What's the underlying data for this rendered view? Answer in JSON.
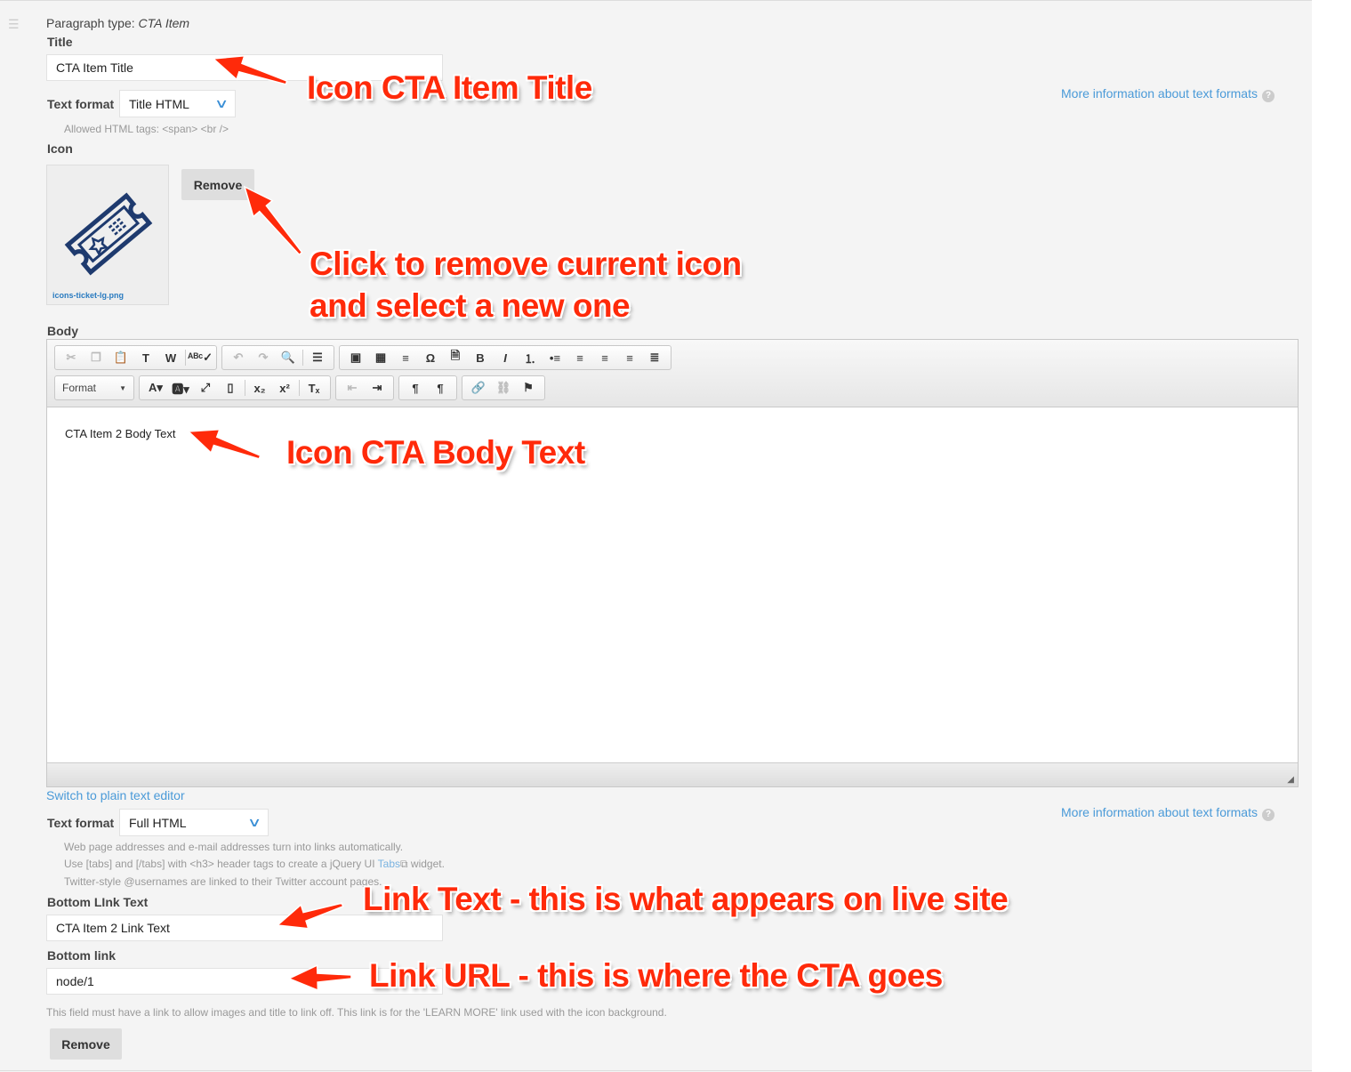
{
  "paragraph_type_prefix": "Paragraph type: ",
  "paragraph_type": "CTA Item",
  "title": {
    "label": "Title",
    "value": "CTA Item Title"
  },
  "title_format": {
    "label": "Text format",
    "value": "Title HTML",
    "help": "Allowed HTML tags: <span> <br />",
    "more_info": "More information about text formats"
  },
  "icon": {
    "label": "Icon",
    "filename": "icons-ticket-lg.png",
    "remove_label": "Remove"
  },
  "body": {
    "label": "Body",
    "content": "CTA Item 2 Body Text",
    "format_dropdown": "Format",
    "toolbar_row1": [
      [
        "cut",
        "copy",
        "paste",
        "paste-text",
        "paste-word",
        "|",
        "spellcheck"
      ],
      [
        "undo",
        "redo",
        "find",
        "|",
        "select-all"
      ],
      [
        "image",
        "table",
        "horizontal-rule",
        "special-char",
        "page-break",
        "bold",
        "italic",
        "numbered-list",
        "bulleted-list",
        "align-left",
        "align-center",
        "align-right",
        "align-justify"
      ]
    ],
    "toolbar_row2": [
      [
        "text-color",
        "bg-color",
        "maximize",
        "show-blocks",
        "|",
        "subscript",
        "superscript",
        "|",
        "remove-format"
      ],
      [
        "outdent",
        "indent"
      ],
      [
        "ltr",
        "rtl"
      ],
      [
        "link",
        "unlink",
        "anchor"
      ]
    ],
    "disabled": [
      "cut",
      "copy",
      "undo",
      "redo",
      "outdent",
      "unlink"
    ]
  },
  "switch_editor": "Switch to plain text editor",
  "body_format": {
    "label": "Text format",
    "value": "Full HTML",
    "more_info": "More information about text formats",
    "help": [
      "Web page addresses and e-mail addresses turn into links automatically.",
      "Use [tabs] and [/tabs] with <h3> header tags to create a jQuery UI ",
      "Twitter-style @usernames are linked to their Twitter account pages."
    ],
    "tabs_link": "Tabs",
    "help_suffix": " widget."
  },
  "link_text": {
    "label": "Bottom LInk Text",
    "value": "CTA Item 2 Link Text"
  },
  "link": {
    "label": "Bottom link",
    "value": "node/1",
    "description": "This field must have a link to allow images and title to link off. This link is for the 'LEARN MORE' link used with the icon background."
  },
  "remove_paragraph": "Remove",
  "annotations": {
    "title": "Icon CTA Item Title",
    "remove_line1": "Click to remove current icon",
    "remove_line2": "and select a new one",
    "body": "Icon CTA Body Text",
    "link_text": "Link Text - this is what appears on live site",
    "link_url": "Link URL - this is where the CTA goes"
  },
  "colors": {
    "annotation": "#ff2a0a",
    "link": "#4a9ad8",
    "icon": "#1e3a6e"
  }
}
